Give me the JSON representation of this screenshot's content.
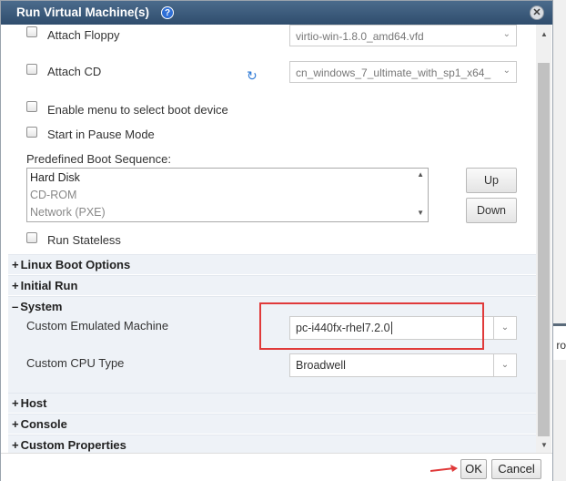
{
  "window": {
    "title": "Run Virtual Machine(s)",
    "help_icon": "?",
    "close_icon": "✕"
  },
  "fields": {
    "attach_floppy": {
      "label": "Attach Floppy",
      "value": "virtio-win-1.8.0_amd64.vfd"
    },
    "attach_cd": {
      "label": "Attach CD",
      "value": "cn_windows_7_ultimate_with_sp1_x64_"
    },
    "enable_boot_menu": {
      "label": "Enable menu to select boot device"
    },
    "start_paused": {
      "label": "Start in Pause Mode"
    },
    "boot_sequence": {
      "label": "Predefined Boot Sequence:",
      "items": [
        "Hard Disk",
        "CD-ROM",
        "Network (PXE)"
      ],
      "up_label": "Up",
      "down_label": "Down"
    },
    "run_stateless": {
      "label": "Run Stateless"
    }
  },
  "sections": {
    "linux_boot": {
      "sign": "+",
      "label": "Linux Boot Options"
    },
    "initial_run": {
      "sign": "+",
      "label": "Initial Run"
    },
    "system": {
      "sign": "–",
      "label": "System",
      "emulated_machine_label": "Custom Emulated Machine",
      "emulated_machine_value": "pc-i440fx-rhel7.2.0",
      "cpu_type_label": "Custom CPU Type",
      "cpu_type_value": "Broadwell"
    },
    "host": {
      "sign": "+",
      "label": "Host"
    },
    "console": {
      "sign": "+",
      "label": "Console"
    },
    "custom_properties": {
      "sign": "+",
      "label": "Custom Properties"
    }
  },
  "footer": {
    "ok_label": "OK",
    "cancel_label": "Cancel"
  },
  "background": {
    "partial_text": "ro"
  },
  "colors": {
    "titlebar": "#3d5d7e",
    "highlight": "#e03a3a",
    "section_bg": "#eef2f7"
  }
}
